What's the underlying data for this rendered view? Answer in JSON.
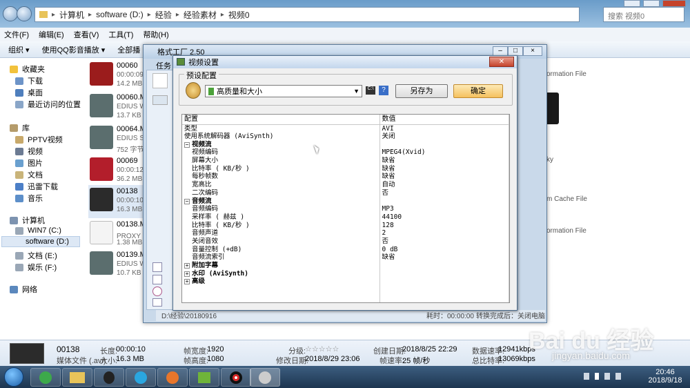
{
  "explorer": {
    "breadcrumb": [
      "计算机",
      "software (D:)",
      "经验",
      "经验素材",
      "视频0"
    ],
    "search_placeholder": "搜索 视频0",
    "menu": [
      "文件(F)",
      "编辑(E)",
      "查看(V)",
      "工具(T)",
      "帮助(H)"
    ],
    "toolbar": {
      "organize": "组织 ▾",
      "qqplay": "使用QQ影音播放 ▾",
      "playall": "全部播"
    },
    "nav": {
      "favorites": "收藏夹",
      "downloads": "下载",
      "desktop": "桌面",
      "recent": "最近访问的位置",
      "libraries": "库",
      "pptv": "PPTV视频",
      "videos": "视频",
      "pictures": "图片",
      "docs": "文档",
      "xunlei": "迅雷下载",
      "music": "音乐",
      "computer": "计算机",
      "c": "WIN7 (C:)",
      "d": "software (D:)",
      "e": "文档 (E:)",
      "f": "娱乐 (F:)",
      "network": "网络"
    },
    "files": [
      {
        "name": "00060",
        "l2": "00:00:09",
        "l3": "14.2 MB"
      },
      {
        "name": "00060.MT",
        "l2": "EDIUS W",
        "l3": "13.7 KB"
      },
      {
        "name": "00064.MT",
        "l2": "EDIUS Se",
        "l3": "752 字节"
      },
      {
        "name": "00069",
        "l2": "00:00:12",
        "l3": "36.2 MB"
      },
      {
        "name": "00138",
        "l2": "00:00:10",
        "l3": "16.3 MB"
      },
      {
        "name": "00138.MT",
        "l2": "PROXY 文",
        "l3": "1.38 MB"
      },
      {
        "name": "00139.MT",
        "l2": "EDIUS W",
        "l3": "10.7 KB"
      }
    ],
    "right_labels": [
      "ormation File",
      "ky",
      "m Cache File",
      "ormation File"
    ],
    "status": {
      "name": "00138",
      "type": "媒体文件 (.avi)",
      "length_label": "长度:",
      "length": "00:00:10",
      "size_label": "大小:",
      "size": "16.3 MB",
      "fw_label": "帧宽度:",
      "fw": "1920",
      "fh_label": "帧高度:",
      "fh": "1080",
      "rating_label": "分级:",
      "rating_stars": "☆☆☆☆☆",
      "mdate_label": "修改日期:",
      "mdate": "2018/8/29 23:06",
      "cdate_label": "创建日期:",
      "cdate": "2018/8/25 22:29",
      "fps_label": "帧速率:",
      "fps": "25 帧/秒",
      "drate_label": "数据速率:",
      "drate": "12941kbps",
      "brate_label": "总比特率:",
      "brate": "13069kbps"
    }
  },
  "ff": {
    "title": "格式工厂 2.50",
    "task_label": "任务",
    "bottom_path": "D:\\经验\\20180916",
    "bottom_time": "耗时：00:00:00",
    "bottom_shutdown": "转换完成后：关闭电脑"
  },
  "dialog": {
    "title": "视频设置",
    "preset_label": "预设配置",
    "preset_value": "高质量和大小",
    "help": "?",
    "saveas": "另存为",
    "ok": "确定",
    "headers": [
      "配置",
      "数值"
    ],
    "rows": [
      {
        "k": "类型",
        "v": "AVI",
        "t": "top"
      },
      {
        "k": "使用系统解码器 (AviSynth)",
        "v": "关闭",
        "t": "top"
      },
      {
        "k": "视频流",
        "v": "",
        "t": "grp",
        "e": "⊟"
      },
      {
        "k": "视频编码",
        "v": "MPEG4(Xvid)",
        "t": "sub"
      },
      {
        "k": "屏幕大小",
        "v": "缺省",
        "t": "sub"
      },
      {
        "k": "比特率 ( KB/秒 )",
        "v": "缺省",
        "t": "sub"
      },
      {
        "k": "每秒帧数",
        "v": "缺省",
        "t": "sub"
      },
      {
        "k": "宽高比",
        "v": "自动",
        "t": "sub"
      },
      {
        "k": "二次编码",
        "v": "否",
        "t": "sub"
      },
      {
        "k": "音频流",
        "v": "",
        "t": "grp",
        "e": "⊟"
      },
      {
        "k": "音频编码",
        "v": "MP3",
        "t": "sub"
      },
      {
        "k": "采样率 ( 赫兹 )",
        "v": "44100",
        "t": "sub"
      },
      {
        "k": "比特率 ( KB/秒 )",
        "v": "128",
        "t": "sub"
      },
      {
        "k": "音频声道",
        "v": "2",
        "t": "sub"
      },
      {
        "k": "关闭音效",
        "v": "否",
        "t": "sub"
      },
      {
        "k": "音量控制 (+dB)",
        "v": "0 dB",
        "t": "sub"
      },
      {
        "k": "音频流索引",
        "v": "缺省",
        "t": "sub"
      },
      {
        "k": "附加字幕",
        "v": "",
        "t": "grp",
        "e": "⊞"
      },
      {
        "k": "水印 (AviSynth)",
        "v": "",
        "t": "grp",
        "e": "⊞"
      },
      {
        "k": "高级",
        "v": "",
        "t": "grp",
        "e": "⊞"
      }
    ]
  },
  "taskbar": {
    "time": "20:46",
    "date": "2018/9/18"
  },
  "watermark": {
    "brand": "Bai du 经验",
    "url": "jingyan.baidu.com"
  }
}
